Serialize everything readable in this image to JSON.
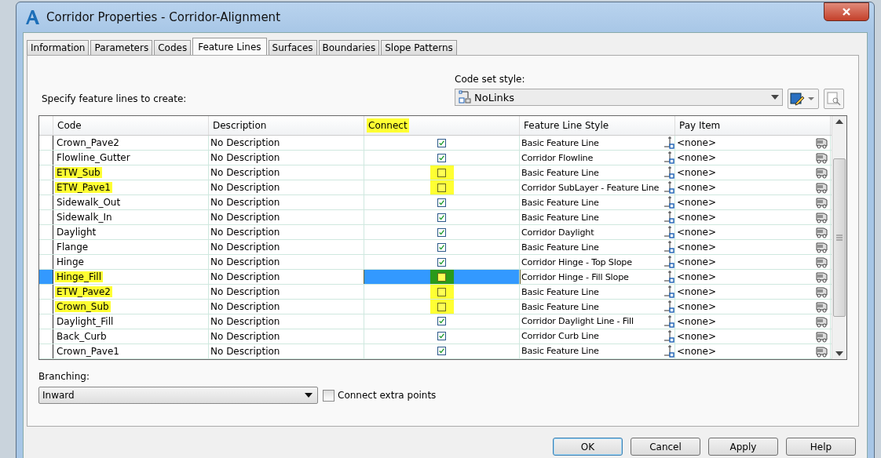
{
  "window": {
    "title": "Corridor Properties - Corridor-Alignment"
  },
  "tabs": [
    {
      "label": "Information",
      "selected": false
    },
    {
      "label": "Parameters",
      "selected": false
    },
    {
      "label": "Codes",
      "selected": false
    },
    {
      "label": "Feature Lines",
      "selected": true
    },
    {
      "label": "Surfaces",
      "selected": false
    },
    {
      "label": "Boundaries",
      "selected": false
    },
    {
      "label": "Slope Patterns",
      "selected": false
    }
  ],
  "instruction": "Specify feature lines to create:",
  "code_set_style": {
    "label": "Code set style:",
    "value": "NoLinks"
  },
  "table": {
    "columns": [
      {
        "label": "Code",
        "highlighted": false
      },
      {
        "label": "Description",
        "highlighted": false
      },
      {
        "label": "Connect",
        "highlighted": true
      },
      {
        "label": "Feature Line Style",
        "highlighted": false
      },
      {
        "label": "Pay Item",
        "highlighted": false
      }
    ],
    "rows": [
      {
        "code": "Crown_Pave2",
        "description": "No Description",
        "connect": true,
        "style": "Basic Feature Line",
        "pay_item": "<none>",
        "highlighted": false,
        "selected": false
      },
      {
        "code": "Flowline_Gutter",
        "description": "No Description",
        "connect": true,
        "style": "Corridor Flowline",
        "pay_item": "<none>",
        "highlighted": false,
        "selected": false
      },
      {
        "code": "ETW_Sub",
        "description": "No Description",
        "connect": false,
        "style": "Basic Feature Line",
        "pay_item": "<none>",
        "highlighted": true,
        "selected": false
      },
      {
        "code": "ETW_Pave1",
        "description": "No Description",
        "connect": false,
        "style": "Corridor SubLayer - Feature Line",
        "pay_item": "<none>",
        "highlighted": true,
        "selected": false
      },
      {
        "code": "Sidewalk_Out",
        "description": "No Description",
        "connect": true,
        "style": "Basic Feature Line",
        "pay_item": "<none>",
        "highlighted": false,
        "selected": false
      },
      {
        "code": "Sidewalk_In",
        "description": "No Description",
        "connect": true,
        "style": "Basic Feature Line",
        "pay_item": "<none>",
        "highlighted": false,
        "selected": false
      },
      {
        "code": "Daylight",
        "description": "No Description",
        "connect": true,
        "style": "Corridor Daylight",
        "pay_item": "<none>",
        "highlighted": false,
        "selected": false
      },
      {
        "code": "Flange",
        "description": "No Description",
        "connect": true,
        "style": "Basic Feature Line",
        "pay_item": "<none>",
        "highlighted": false,
        "selected": false
      },
      {
        "code": "Hinge",
        "description": "No Description",
        "connect": true,
        "style": "Corridor Hinge - Top Slope",
        "pay_item": "<none>",
        "highlighted": false,
        "selected": false
      },
      {
        "code": "Hinge_Fill",
        "description": "No Description",
        "connect": false,
        "style": "Corridor Hinge - Fill Slope",
        "pay_item": "<none>",
        "highlighted": true,
        "selected": true
      },
      {
        "code": "ETW_Pave2",
        "description": "No Description",
        "connect": false,
        "style": "Basic Feature Line",
        "pay_item": "<none>",
        "highlighted": true,
        "selected": false
      },
      {
        "code": "Crown_Sub",
        "description": "No Description",
        "connect": false,
        "style": "Basic Feature Line",
        "pay_item": "<none>",
        "highlighted": true,
        "selected": false
      },
      {
        "code": "Daylight_Fill",
        "description": "No Description",
        "connect": true,
        "style": "Corridor Daylight Line - Fill",
        "pay_item": "<none>",
        "highlighted": false,
        "selected": false
      },
      {
        "code": "Back_Curb",
        "description": "No Description",
        "connect": true,
        "style": "Corridor Curb Line",
        "pay_item": "<none>",
        "highlighted": false,
        "selected": false
      },
      {
        "code": "Crown_Pave1",
        "description": "No Description",
        "connect": true,
        "style": "Basic Feature Line",
        "pay_item": "<none>",
        "highlighted": false,
        "selected": false
      }
    ]
  },
  "branching": {
    "label": "Branching:",
    "value": "Inward"
  },
  "connect_extra_points": {
    "label": "Connect extra points",
    "checked": false
  },
  "buttons": [
    {
      "label": "OK",
      "default": true
    },
    {
      "label": "Cancel",
      "default": false
    },
    {
      "label": "Apply",
      "default": false
    },
    {
      "label": "Help",
      "default": false
    }
  ]
}
